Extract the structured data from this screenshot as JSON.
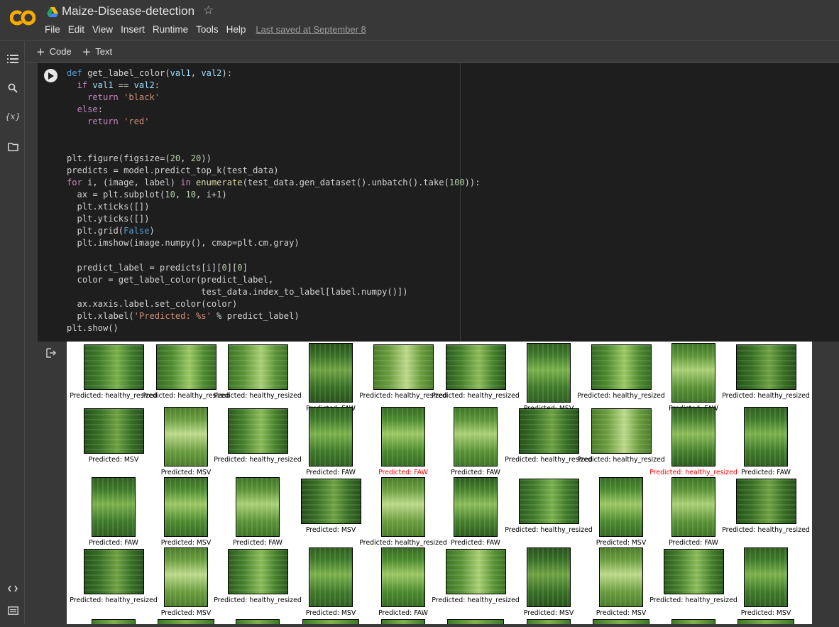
{
  "app": {
    "notebook_title": "Maize-Disease-detection",
    "menu": [
      "File",
      "Edit",
      "View",
      "Insert",
      "Runtime",
      "Tools",
      "Help"
    ],
    "last_saved": "Last saved at September 8"
  },
  "toolbar": {
    "add_code": "Code",
    "add_text": "Text"
  },
  "sidebar": {
    "icons": [
      "table-of-contents-icon",
      "search-icon",
      "variables-icon",
      "files-icon",
      "code-snippets-icon",
      "terminal-icon"
    ],
    "variables_glyph": "{x}"
  },
  "cell": {
    "code_lines": [
      "def get_label_color(val1, val2):",
      "  if val1 == val2:",
      "    return 'black'",
      "  else:",
      "    return 'red'",
      "",
      "",
      "plt.figure(figsize=(20, 20))",
      "predicts = model.predict_top_k(test_data)",
      "for i, (image, label) in enumerate(test_data.gen_dataset().unbatch().take(100)):",
      "  ax = plt.subplot(10, 10, i+1)",
      "  plt.xticks([])",
      "  plt.yticks([])",
      "  plt.grid(False)",
      "  plt.imshow(image.numpy(), cmap=plt.cm.gray)",
      "",
      "  predict_label = predicts[i][0][0]",
      "  color = get_label_color(predict_label,",
      "                          test_data.index_to_label[label.numpy()])",
      "  ax.xaxis.label.set_color(color)",
      "  plt.xlabel('Predicted: %s' % predict_label)",
      "plt.show()"
    ]
  },
  "output": {
    "caption_prefix": "Predicted: ",
    "rows": [
      [
        {
          "label": "Predicted: healthy_resized",
          "color": "black",
          "shape": "wide"
        },
        {
          "label": "Predicted: healthy_resized",
          "color": "black",
          "shape": "wide"
        },
        {
          "label": "Predicted: healthy_resized",
          "color": "black",
          "shape": "wide"
        },
        {
          "label": "Predicted: FAW",
          "color": "black",
          "shape": "tall"
        },
        {
          "label": "Predicted: healthy_resized",
          "color": "black",
          "shape": "wide"
        },
        {
          "label": "Predicted: healthy_resized",
          "color": "black",
          "shape": "wide"
        },
        {
          "label": "Predicted: MSV",
          "color": "black",
          "shape": "tall"
        },
        {
          "label": "Predicted: healthy_resized",
          "color": "black",
          "shape": "wide"
        },
        {
          "label": "Predicted: FAW",
          "color": "black",
          "shape": "tall"
        },
        {
          "label": "Predicted: healthy_resized",
          "color": "black",
          "shape": "wide"
        }
      ],
      [
        {
          "label": "Predicted: MSV",
          "color": "black",
          "shape": "wide"
        },
        {
          "label": "Predicted: MSV",
          "color": "black",
          "shape": "tall"
        },
        {
          "label": "Predicted: healthy_resized",
          "color": "black",
          "shape": "wide"
        },
        {
          "label": "Predicted: FAW",
          "color": "black",
          "shape": "tall"
        },
        {
          "label": "Predicted: FAW",
          "color": "red",
          "shape": "tall"
        },
        {
          "label": "Predicted: FAW",
          "color": "black",
          "shape": "tall"
        },
        {
          "label": "Predicted: healthy_resized",
          "color": "black",
          "shape": "wide"
        },
        {
          "label": "Predicted: healthy_resized",
          "color": "black",
          "shape": "wide"
        },
        {
          "label": "Predicted: healthy_resized",
          "color": "red",
          "shape": "tall"
        },
        {
          "label": "Predicted: FAW",
          "color": "black",
          "shape": "tall"
        }
      ],
      [
        {
          "label": "Predicted: FAW",
          "color": "black",
          "shape": "tall"
        },
        {
          "label": "Predicted: MSV",
          "color": "black",
          "shape": "tall"
        },
        {
          "label": "Predicted: FAW",
          "color": "black",
          "shape": "tall"
        },
        {
          "label": "Predicted: MSV",
          "color": "black",
          "shape": "wide"
        },
        {
          "label": "Predicted: healthy_resized",
          "color": "black",
          "shape": "tall"
        },
        {
          "label": "Predicted: FAW",
          "color": "black",
          "shape": "tall"
        },
        {
          "label": "Predicted: healthy_resized",
          "color": "black",
          "shape": "wide"
        },
        {
          "label": "Predicted: MSV",
          "color": "black",
          "shape": "tall"
        },
        {
          "label": "Predicted: FAW",
          "color": "black",
          "shape": "tall"
        },
        {
          "label": "Predicted: healthy_resized",
          "color": "black",
          "shape": "wide"
        }
      ],
      [
        {
          "label": "Predicted: healthy_resized",
          "color": "black",
          "shape": "wide"
        },
        {
          "label": "Predicted: MSV",
          "color": "black",
          "shape": "tall"
        },
        {
          "label": "Predicted: healthy_resized",
          "color": "black",
          "shape": "wide"
        },
        {
          "label": "Predicted: MSV",
          "color": "black",
          "shape": "tall"
        },
        {
          "label": "Predicted: FAW",
          "color": "black",
          "shape": "tall"
        },
        {
          "label": "Predicted: healthy_resized",
          "color": "black",
          "shape": "wide"
        },
        {
          "label": "Predicted: MSV",
          "color": "black",
          "shape": "tall"
        },
        {
          "label": "Predicted: MSV",
          "color": "black",
          "shape": "tall"
        },
        {
          "label": "Predicted: healthy_resized",
          "color": "black",
          "shape": "wide"
        },
        {
          "label": "Predicted: MSV",
          "color": "black",
          "shape": "tall"
        }
      ]
    ]
  }
}
